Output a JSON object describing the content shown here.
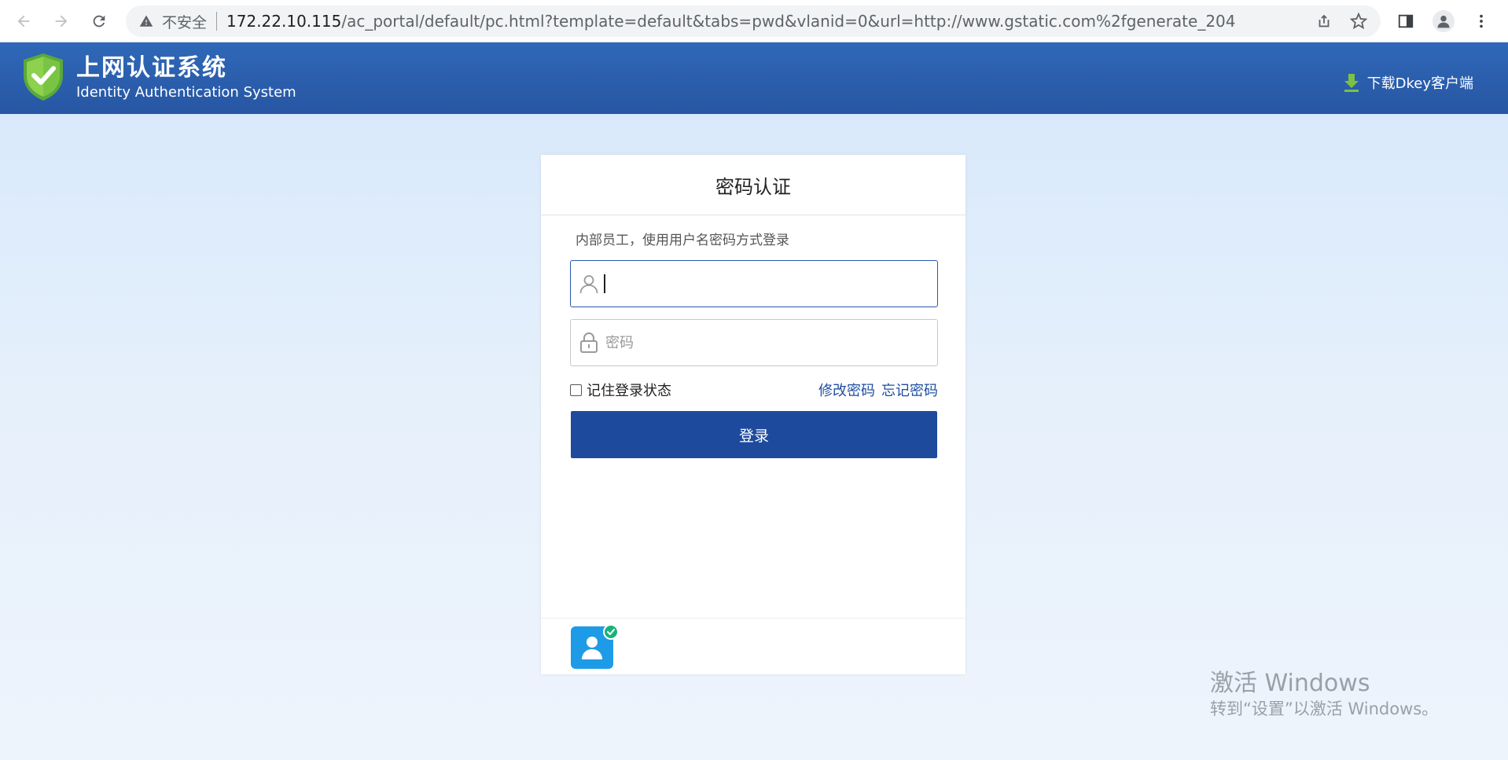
{
  "browser": {
    "security_label": "不安全",
    "url_host": "172.22.10.115",
    "url_path": "/ac_portal/default/pc.html?template=default&tabs=pwd&vlanid=0&url=http://www.gstatic.com%2fgenerate_204"
  },
  "header": {
    "title": "上网认证系统",
    "subtitle": "Identity Authentication System",
    "download_label": "下载Dkey客户端"
  },
  "login": {
    "card_title": "密码认证",
    "hint": "内部员工，使用用户名密码方式登录",
    "username_value": "",
    "password_placeholder": "密码",
    "remember_label": "记住登录状态",
    "change_password_label": "修改密码",
    "forgot_password_label": "忘记密码",
    "submit_label": "登录"
  },
  "watermark": {
    "line1": "激活 Windows",
    "line2": "转到“设置”以激活 Windows。"
  },
  "colors": {
    "header_bg": "#2f68b8",
    "primary_button": "#1e4a9e",
    "link": "#1f4ea1",
    "shield_green": "#7cc242",
    "auth_icon_blue": "#1e9be6"
  }
}
